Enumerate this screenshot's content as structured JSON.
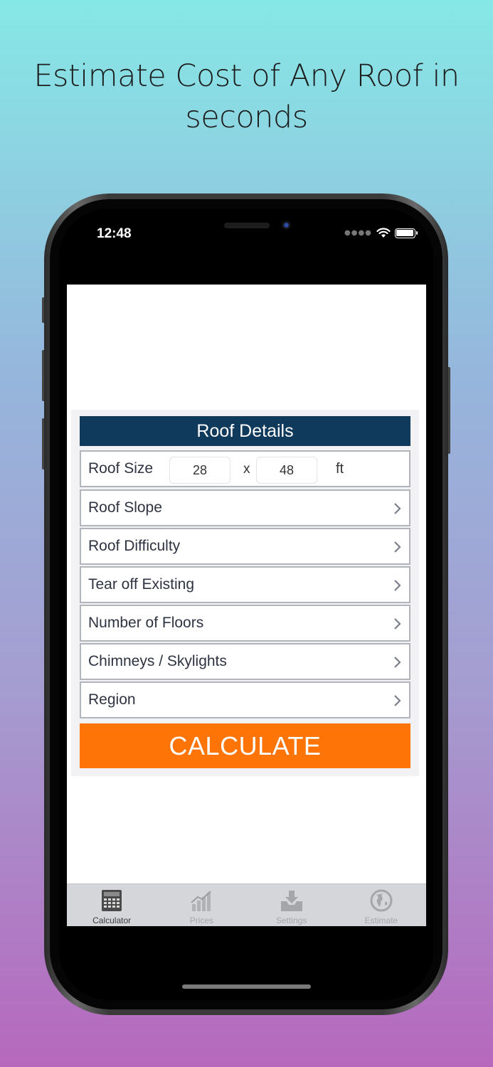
{
  "headline": {
    "line1": "Estimate Cost of Any Roof in",
    "line2": "seconds"
  },
  "status_bar": {
    "time": "12:48",
    "icons": [
      "signal-dots-icon",
      "wifi-icon",
      "battery-icon"
    ]
  },
  "panel": {
    "title": "Roof Details",
    "roof_size": {
      "label": "Roof Size",
      "width_value": "28",
      "separator": "x",
      "length_value": "48",
      "unit": "ft"
    },
    "rows": [
      {
        "label": "Roof Slope"
      },
      {
        "label": "Roof Difficulty"
      },
      {
        "label": "Tear off Existing"
      },
      {
        "label": "Number of Floors"
      },
      {
        "label": "Chimneys / Skylights"
      },
      {
        "label": "Region"
      }
    ],
    "calculate_label": "CALCULATE"
  },
  "colors": {
    "header_bg": "#0f3a5b",
    "button_bg": "#ff7406",
    "tabbar_bg": "#d4d6da"
  },
  "tabbar": {
    "tabs": [
      {
        "label": "Calculator",
        "icon": "calculator-icon",
        "active": true
      },
      {
        "label": "Prices",
        "icon": "chart-icon",
        "active": false
      },
      {
        "label": "Settings",
        "icon": "inbox-icon",
        "active": false
      },
      {
        "label": "Estimate",
        "icon": "globe-icon",
        "active": false
      }
    ]
  }
}
